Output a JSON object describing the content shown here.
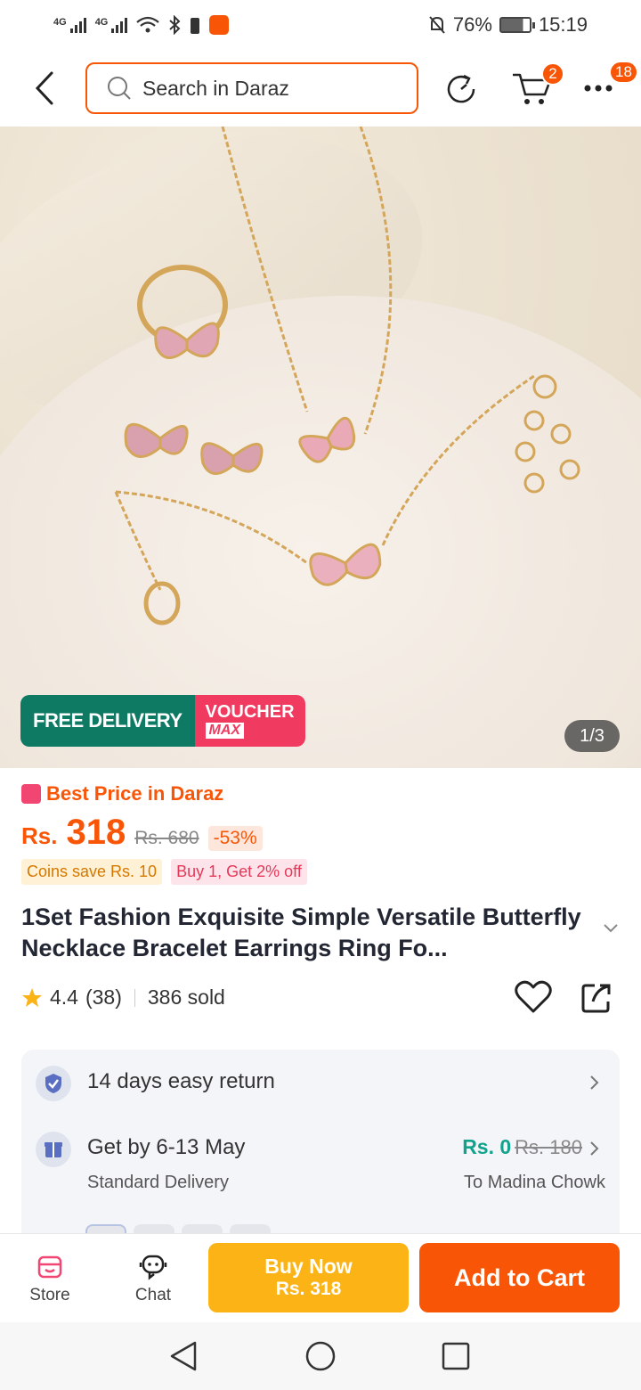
{
  "status_bar": {
    "network_1": "4G",
    "network_2": "4G",
    "battery": "76%",
    "time": "15:19"
  },
  "header": {
    "search_placeholder": "Search in Daraz",
    "cart_count": "2",
    "more_count": "18"
  },
  "product_image": {
    "free_delivery": "FREE DELIVERY",
    "voucher_line1": "VOUCHER",
    "voucher_line2": "MAX",
    "counter": "1/3"
  },
  "price": {
    "best_price_label": "Best Price in Daraz",
    "currency": "Rs.",
    "current": "318",
    "original": "Rs. 680",
    "discount": "-53%",
    "promo_coins": "Coins save Rs. 10",
    "promo_buy": "Buy 1, Get 2% off"
  },
  "product": {
    "title": "1Set Fashion Exquisite Simple Versatile Butterfly Necklace Bracelet Earrings Ring Fo...",
    "rating": "4.4",
    "rating_count": "(38)",
    "sold": "386 sold"
  },
  "delivery": {
    "return_text": "14 days easy return",
    "delivery_text": "Get by 6-13 May",
    "delivery_type": "Standard Delivery",
    "fee": "Rs. 0",
    "fee_original": "Rs. 180",
    "location": "To Madina Chowk"
  },
  "bottom_bar": {
    "store_label": "Store",
    "chat_label": "Chat",
    "buy_now_label": "Buy Now",
    "buy_now_price": "Rs. 318",
    "add_to_cart_label": "Add to Cart"
  },
  "colors": {
    "brand": "#f85606",
    "buy_now": "#fcb315",
    "free_delivery": "#0f7a63",
    "voucher": "#f03a5f"
  }
}
